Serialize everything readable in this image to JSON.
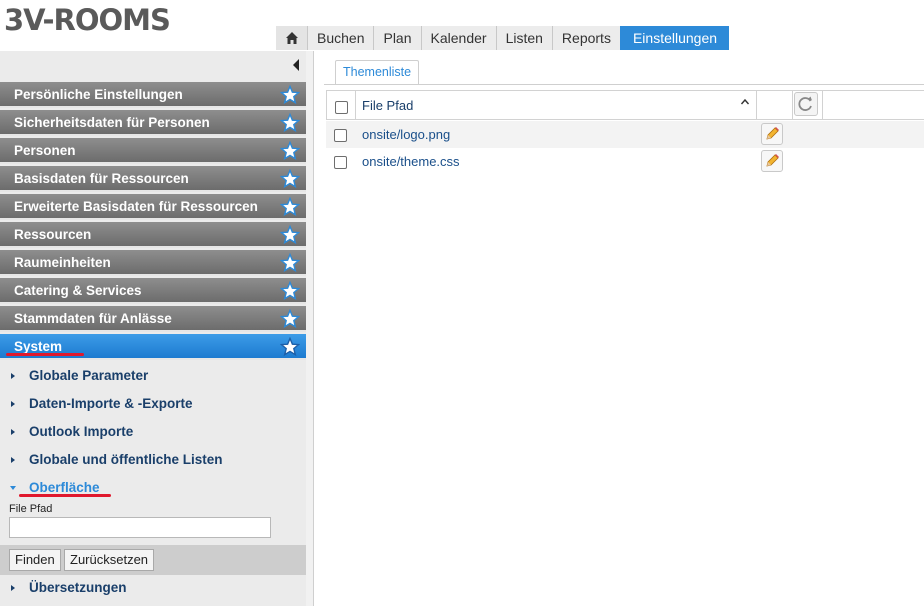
{
  "app": {
    "logo_text": "3V-ROOMS"
  },
  "nav": {
    "home_icon": "home-icon",
    "tabs": [
      {
        "label": "Buchen"
      },
      {
        "label": "Plan"
      },
      {
        "label": "Kalender"
      },
      {
        "label": "Listen"
      },
      {
        "label": "Reports"
      },
      {
        "label": "Einstellungen",
        "active": true
      }
    ]
  },
  "sidebar": {
    "collapse_icon": "chevron-left-icon",
    "sections": [
      {
        "label": "Persönliche Einstellungen"
      },
      {
        "label": "Sicherheitsdaten für Personen"
      },
      {
        "label": "Personen"
      },
      {
        "label": "Basisdaten für Ressourcen"
      },
      {
        "label": "Erweiterte Basisdaten für Ressourcen"
      },
      {
        "label": "Ressourcen"
      },
      {
        "label": "Raumeinheiten"
      },
      {
        "label": "Catering & Services"
      },
      {
        "label": "Stammdaten für Anlässe"
      },
      {
        "label": "System",
        "active": true
      }
    ],
    "subitems": [
      {
        "label": "Globale Parameter"
      },
      {
        "label": "Daten-Importe & -Exporte"
      },
      {
        "label": "Outlook Importe"
      },
      {
        "label": "Globale und öffentliche Listen"
      },
      {
        "label": "Oberfläche",
        "open": true
      },
      {
        "label": "Übersetzungen"
      }
    ],
    "filter": {
      "label": "File Pfad",
      "value": "",
      "find_button": "Finden",
      "reset_button": "Zurücksetzen"
    }
  },
  "main": {
    "tab_label": "Themenliste",
    "grid": {
      "column_header": "File Pfad",
      "sort": "ascending",
      "rows": [
        {
          "file": "onsite/logo.png"
        },
        {
          "file": "onsite/theme.css"
        }
      ]
    }
  },
  "colors": {
    "accent": "#2d8ad8",
    "highlight_underline": "#e0182d",
    "section_gray": "#7a7a7a"
  }
}
